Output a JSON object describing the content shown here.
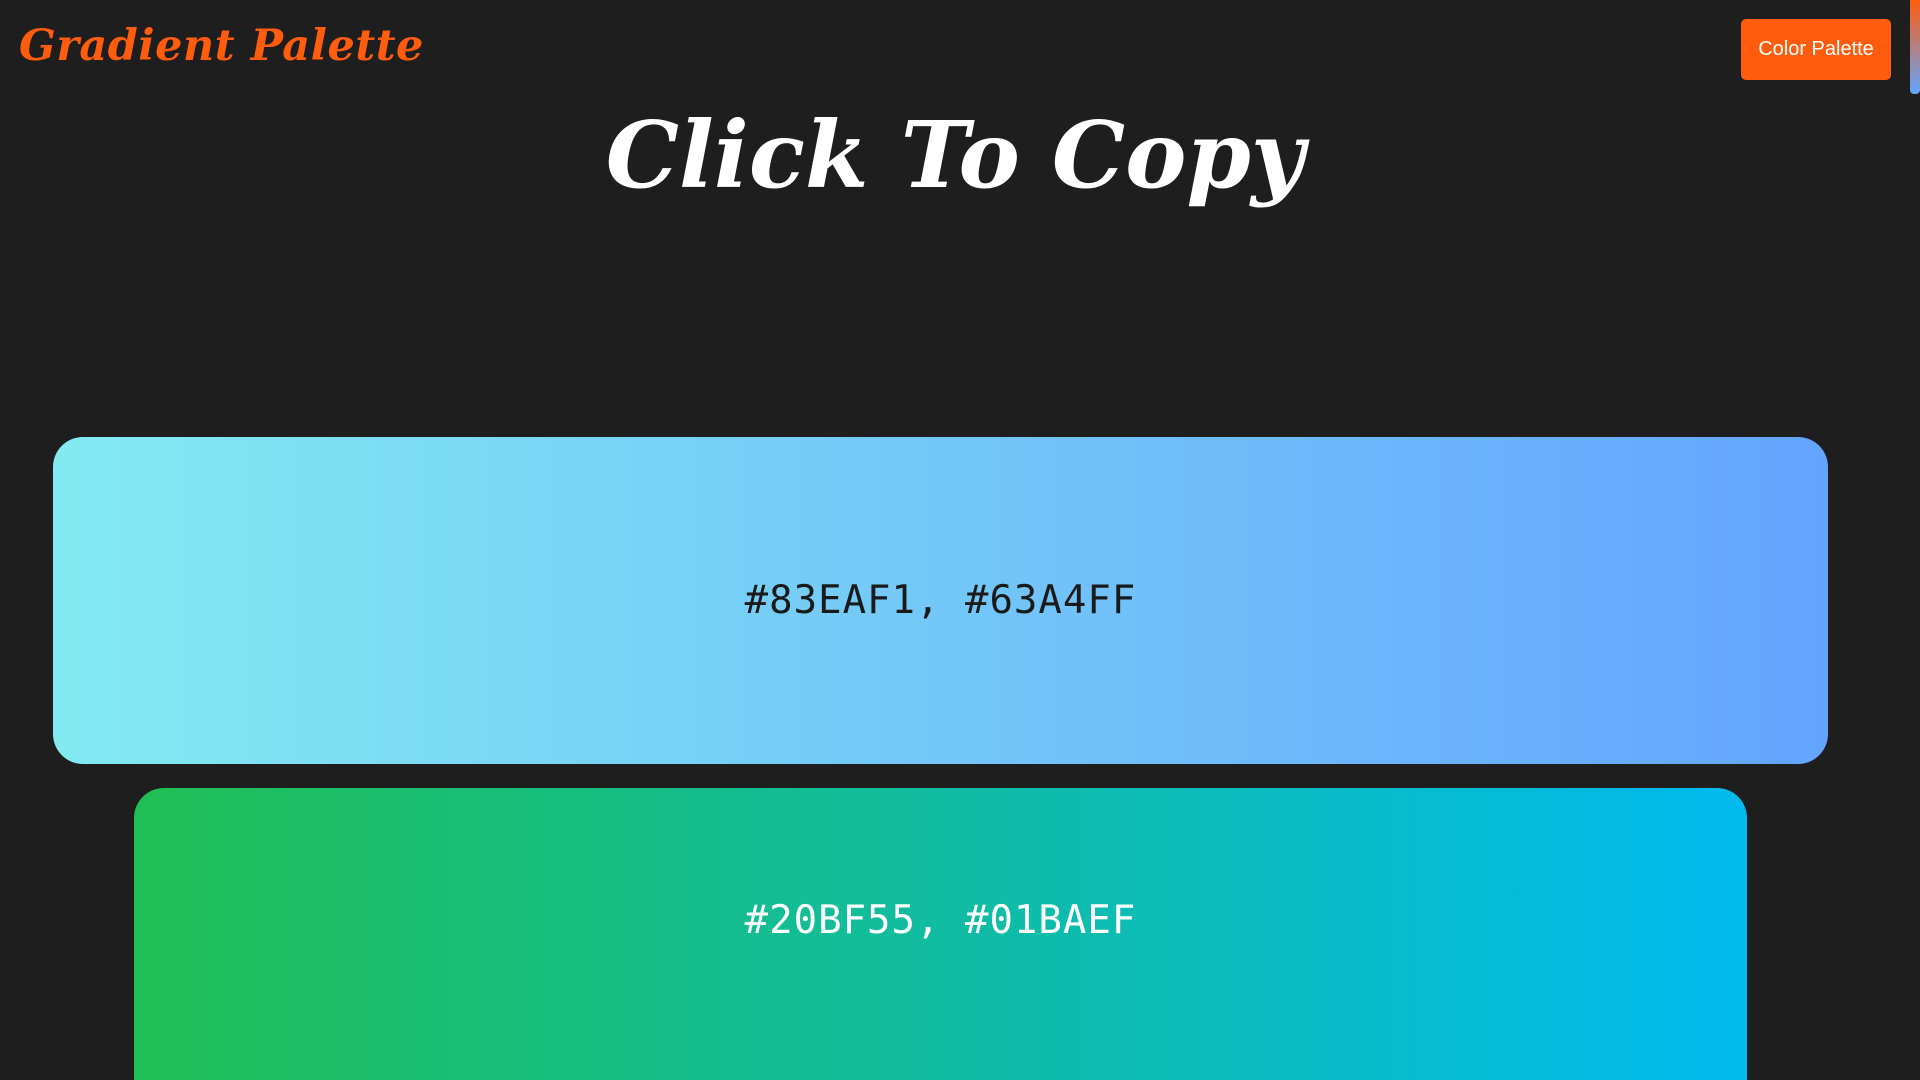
{
  "header": {
    "brand": "Gradient Palette",
    "nav_button_label": "Color Palette"
  },
  "main": {
    "headline": "Click To Copy",
    "gradients": [
      {
        "label": "#83EAF1, #63A4FF",
        "color_start": "#83EAF1",
        "color_end": "#63A4FF",
        "text_color": "#1a1a1a"
      },
      {
        "label": "#20BF55, #01BAEF",
        "color_start": "#20BF55",
        "color_end": "#01BAEF",
        "text_color": "#ffffff"
      }
    ]
  },
  "colors": {
    "background": "#1e1e1e",
    "accent": "#ff5d0d",
    "headline": "#ffffff"
  }
}
